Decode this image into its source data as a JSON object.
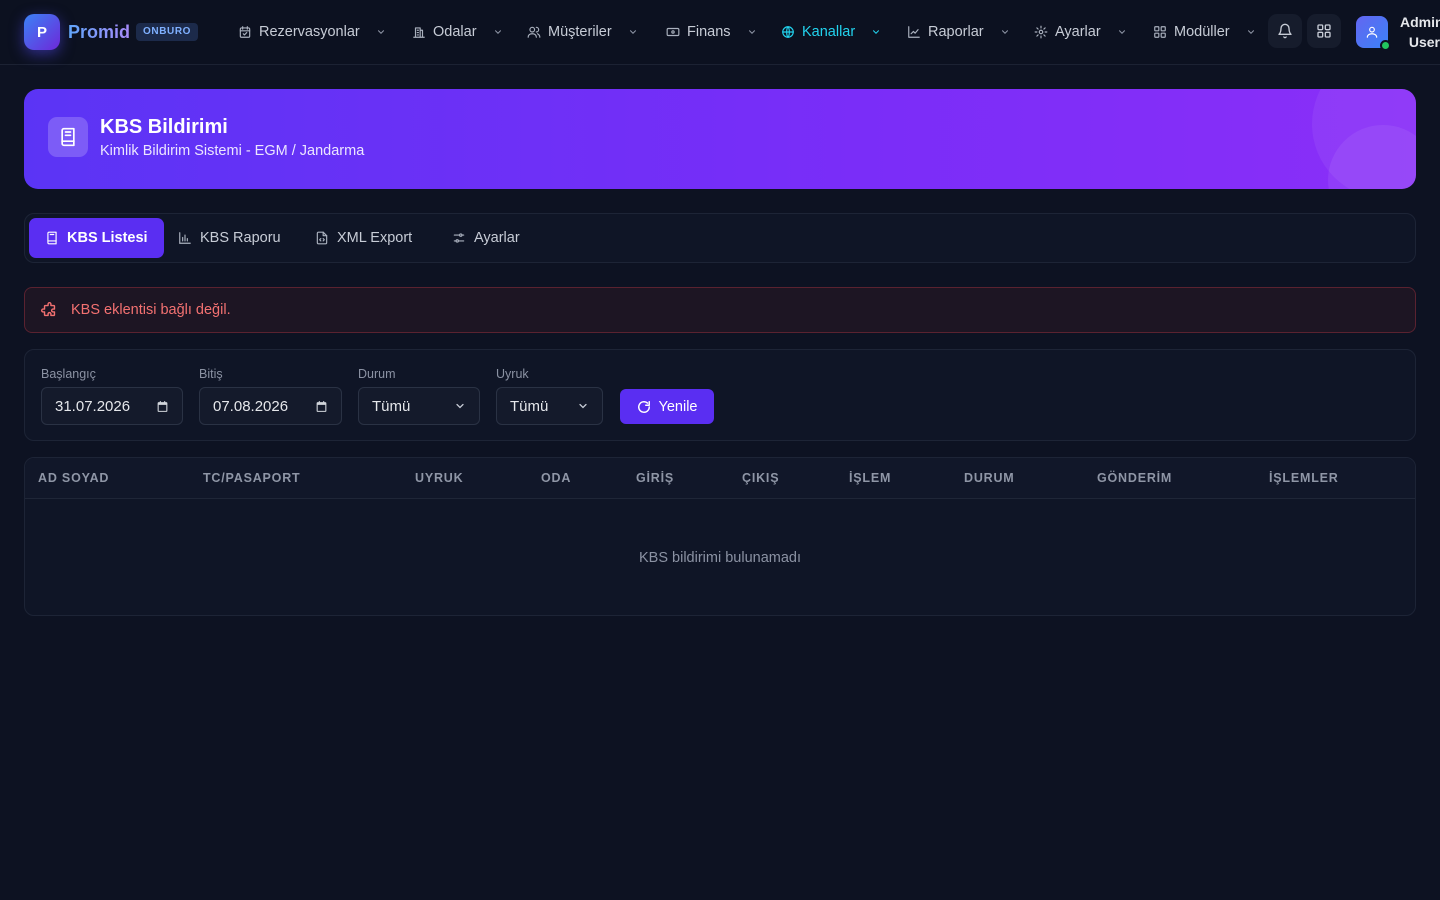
{
  "brand": {
    "logo_letter": "P",
    "name": "Promid",
    "badge": "ONBURO"
  },
  "nav": {
    "items": [
      {
        "label": "Rezervasyonlar",
        "icon": "calendar-icon"
      },
      {
        "label": "Odalar",
        "icon": "building-icon"
      },
      {
        "label": "Müşteriler",
        "icon": "users-icon"
      },
      {
        "label": "Finans",
        "icon": "banknote-icon"
      },
      {
        "label": "Kanallar",
        "icon": "globe-icon",
        "active": true
      },
      {
        "label": "Raporlar",
        "icon": "line-chart-icon"
      },
      {
        "label": "Ayarlar",
        "icon": "gear-icon"
      },
      {
        "label": "Modüller",
        "icon": "grid-icon"
      }
    ],
    "user": {
      "line1": "Admin",
      "line2": "User"
    }
  },
  "hero": {
    "title": "KBS Bildirimi",
    "subtitle": "Kimlik Bildirim Sistemi - EGM / Jandarma",
    "icon": "book-icon"
  },
  "tabs": [
    {
      "label": "KBS Listesi",
      "icon": "book-icon",
      "active": true
    },
    {
      "label": "KBS Raporu",
      "icon": "bar-chart-icon"
    },
    {
      "label": "XML Export",
      "icon": "file-code-icon"
    },
    {
      "label": "Ayarlar",
      "icon": "sliders-icon"
    }
  ],
  "alert": {
    "text": "KBS eklentisi bağlı değil.",
    "icon": "puzzle-icon"
  },
  "filters": {
    "start": {
      "label": "Başlangıç",
      "value": "31.07.2026"
    },
    "end": {
      "label": "Bitiş",
      "value": "07.08.2026"
    },
    "status": {
      "label": "Durum",
      "value": "Tümü"
    },
    "nationality": {
      "label": "Uyruk",
      "value": "Tümü"
    },
    "refresh_label": "Yenile"
  },
  "table": {
    "columns": [
      "AD SOYAD",
      "TC/PASAPORT",
      "UYRUK",
      "ODA",
      "GİRİŞ",
      "ÇIKIŞ",
      "İŞLEM",
      "DURUM",
      "GÖNDERİM",
      "İŞLEMLER"
    ],
    "rows": [],
    "empty_text": "KBS bildirimi bulunamadı"
  },
  "colors": {
    "background": "#0d1222",
    "accent": "#5a2ef2",
    "active_nav": "#22d3ee",
    "alert_text": "#f37171",
    "online": "#22c55e"
  }
}
